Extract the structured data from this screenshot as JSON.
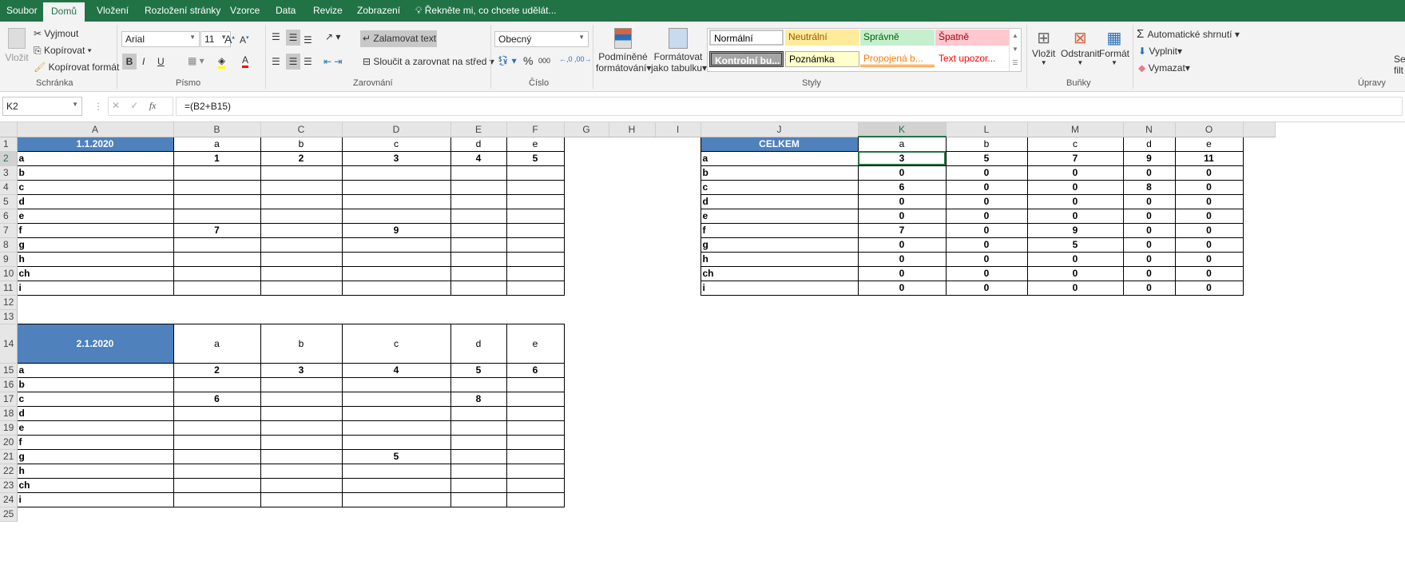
{
  "tabs": [
    "Soubor",
    "Domů",
    "Vložení",
    "Rozložení stránky",
    "Vzorce",
    "Data",
    "Revize",
    "Zobrazení"
  ],
  "tell_me": "Řekněte mi, co chcete udělát...",
  "ribbon": {
    "clipboard": {
      "paste": "Vložit",
      "cut": "Vyjmout",
      "copy": "Kopírovat",
      "format_painter": "Kopírovat formát",
      "label": "Schránka"
    },
    "font": {
      "name": "Arial",
      "size": "11",
      "bold": "B",
      "italic": "I",
      "underline": "U",
      "label": "Písmo"
    },
    "alignment": {
      "wrap": "Zalamovat text",
      "merge": "Sloučit a zarovnat na střed",
      "label": "Zarovnání"
    },
    "number": {
      "format": "Obecný",
      "percent": "%",
      "thousands": "000",
      "label": "Číslo"
    },
    "styles": {
      "conditional": [
        "Podmíněné",
        "formátování"
      ],
      "as_table": [
        "Formátovat",
        "jako tabulku"
      ],
      "items": [
        {
          "label": "Normální",
          "bg": "#ffffff",
          "fg": "#000000"
        },
        {
          "label": "Neutrální",
          "bg": "#ffeb9c",
          "fg": "#9c5700"
        },
        {
          "label": "Správně",
          "bg": "#c6efce",
          "fg": "#006100"
        },
        {
          "label": "Špatně",
          "bg": "#ffc7ce",
          "fg": "#9c0006"
        },
        {
          "label": "Kontrolní bu...",
          "bg": "#a5a5a5",
          "fg": "#ffffff"
        },
        {
          "label": "Poznámka",
          "bg": "#ffffcc",
          "fg": "#000000"
        },
        {
          "label": "Propojená b...",
          "bg": "#ffffff",
          "fg": "#fa7d00"
        },
        {
          "label": "Text upozor...",
          "bg": "#ffffff",
          "fg": "#ff0000"
        }
      ],
      "label": "Styly"
    },
    "cells": {
      "insert": "Vložit",
      "delete": "Odstranit",
      "format": "Formát",
      "label": "Buňky"
    },
    "editing": {
      "autosum": "Automatické shrnutí",
      "fill": "Vyplnit",
      "clear": "Vymazat",
      "sort": [
        "Se",
        "filt"
      ],
      "label": "Úpravy"
    }
  },
  "formula_bar": {
    "name_box": "K2",
    "formula": "=(B2+B15)",
    "fx": "fx"
  },
  "sheet": {
    "active_cell": "K2",
    "accent": "#4f81bd",
    "columns": [
      "A",
      "B",
      "C",
      "D",
      "E",
      "F",
      "G",
      "H",
      "I",
      "J",
      "K",
      "L",
      "M",
      "N",
      "O",
      ""
    ],
    "rows": [
      {
        "n": "1",
        "c": [
          "1.1.2020",
          "a",
          "b",
          "c",
          "d",
          "e",
          "",
          "",
          "",
          "CELKEM",
          "a",
          "b",
          "c",
          "d",
          "e",
          ""
        ]
      },
      {
        "n": "2",
        "c": [
          "a",
          "1",
          "2",
          "3",
          "4",
          "5",
          "",
          "",
          "",
          "a",
          "3",
          "5",
          "7",
          "9",
          "11",
          ""
        ]
      },
      {
        "n": "3",
        "c": [
          "b",
          "",
          "",
          "",
          "",
          "",
          "",
          "",
          "",
          "b",
          "0",
          "0",
          "0",
          "0",
          "0",
          ""
        ]
      },
      {
        "n": "4",
        "c": [
          "c",
          "",
          "",
          "",
          "",
          "",
          "",
          "",
          "",
          "c",
          "6",
          "0",
          "0",
          "8",
          "0",
          ""
        ]
      },
      {
        "n": "5",
        "c": [
          "d",
          "",
          "",
          "",
          "",
          "",
          "",
          "",
          "",
          "d",
          "0",
          "0",
          "0",
          "0",
          "0",
          ""
        ]
      },
      {
        "n": "6",
        "c": [
          "e",
          "",
          "",
          "",
          "",
          "",
          "",
          "",
          "",
          "e",
          "0",
          "0",
          "0",
          "0",
          "0",
          ""
        ]
      },
      {
        "n": "7",
        "c": [
          "f",
          "7",
          "",
          "9",
          "",
          "",
          "",
          "",
          "",
          "f",
          "7",
          "0",
          "9",
          "0",
          "0",
          ""
        ]
      },
      {
        "n": "8",
        "c": [
          "g",
          "",
          "",
          "",
          "",
          "",
          "",
          "",
          "",
          "g",
          "0",
          "0",
          "5",
          "0",
          "0",
          ""
        ]
      },
      {
        "n": "9",
        "c": [
          "h",
          "",
          "",
          "",
          "",
          "",
          "",
          "",
          "",
          "h",
          "0",
          "0",
          "0",
          "0",
          "0",
          ""
        ]
      },
      {
        "n": "10",
        "c": [
          "ch",
          "",
          "",
          "",
          "",
          "",
          "",
          "",
          "",
          "ch",
          "0",
          "0",
          "0",
          "0",
          "0",
          ""
        ]
      },
      {
        "n": "11",
        "c": [
          "i",
          "",
          "",
          "",
          "",
          "",
          "",
          "",
          "",
          "i",
          "0",
          "0",
          "0",
          "0",
          "0",
          ""
        ]
      },
      {
        "n": "12",
        "c": [
          "",
          "",
          "",
          "",
          "",
          "",
          "",
          "",
          "",
          "",
          "",
          "",
          "",
          "",
          "",
          ""
        ]
      },
      {
        "n": "13",
        "c": [
          "",
          "",
          "",
          "",
          "",
          "",
          "",
          "",
          "",
          "",
          "",
          "",
          "",
          "",
          "",
          ""
        ]
      },
      {
        "n": "14",
        "c": [
          "2.1.2020",
          "a",
          "b",
          "c",
          "d",
          "e",
          "",
          "",
          "",
          "",
          "",
          "",
          "",
          "",
          "",
          ""
        ]
      },
      {
        "n": "15",
        "c": [
          "a",
          "2",
          "3",
          "4",
          "5",
          "6",
          "",
          "",
          "",
          "",
          "",
          "",
          "",
          "",
          "",
          ""
        ]
      },
      {
        "n": "16",
        "c": [
          "b",
          "",
          "",
          "",
          "",
          "",
          "",
          "",
          "",
          "",
          "",
          "",
          "",
          "",
          "",
          ""
        ]
      },
      {
        "n": "17",
        "c": [
          "c",
          "6",
          "",
          "",
          "8",
          "",
          "",
          "",
          "",
          "",
          "",
          "",
          "",
          "",
          "",
          ""
        ]
      },
      {
        "n": "18",
        "c": [
          "d",
          "",
          "",
          "",
          "",
          "",
          "",
          "",
          "",
          "",
          "",
          "",
          "",
          "",
          "",
          ""
        ]
      },
      {
        "n": "19",
        "c": [
          "e",
          "",
          "",
          "",
          "",
          "",
          "",
          "",
          "",
          "",
          "",
          "",
          "",
          "",
          "",
          ""
        ]
      },
      {
        "n": "20",
        "c": [
          "f",
          "",
          "",
          "",
          "",
          "",
          "",
          "",
          "",
          "",
          "",
          "",
          "",
          "",
          "",
          ""
        ]
      },
      {
        "n": "21",
        "c": [
          "g",
          "",
          "",
          "5",
          "",
          "",
          "",
          "",
          "",
          "",
          "",
          "",
          "",
          "",
          "",
          ""
        ]
      },
      {
        "n": "22",
        "c": [
          "h",
          "",
          "",
          "",
          "",
          "",
          "",
          "",
          "",
          "",
          "",
          "",
          "",
          "",
          "",
          ""
        ]
      },
      {
        "n": "23",
        "c": [
          "ch",
          "",
          "",
          "",
          "",
          "",
          "",
          "",
          "",
          "",
          "",
          "",
          "",
          "",
          "",
          ""
        ]
      },
      {
        "n": "24",
        "c": [
          "i",
          "",
          "",
          "",
          "",
          "",
          "",
          "",
          "",
          "",
          "",
          "",
          "",
          "",
          "",
          ""
        ]
      },
      {
        "n": "25",
        "c": [
          "",
          "",
          "",
          "",
          "",
          "",
          "",
          "",
          "",
          "",
          "",
          "",
          "",
          "",
          "",
          ""
        ]
      }
    ]
  }
}
